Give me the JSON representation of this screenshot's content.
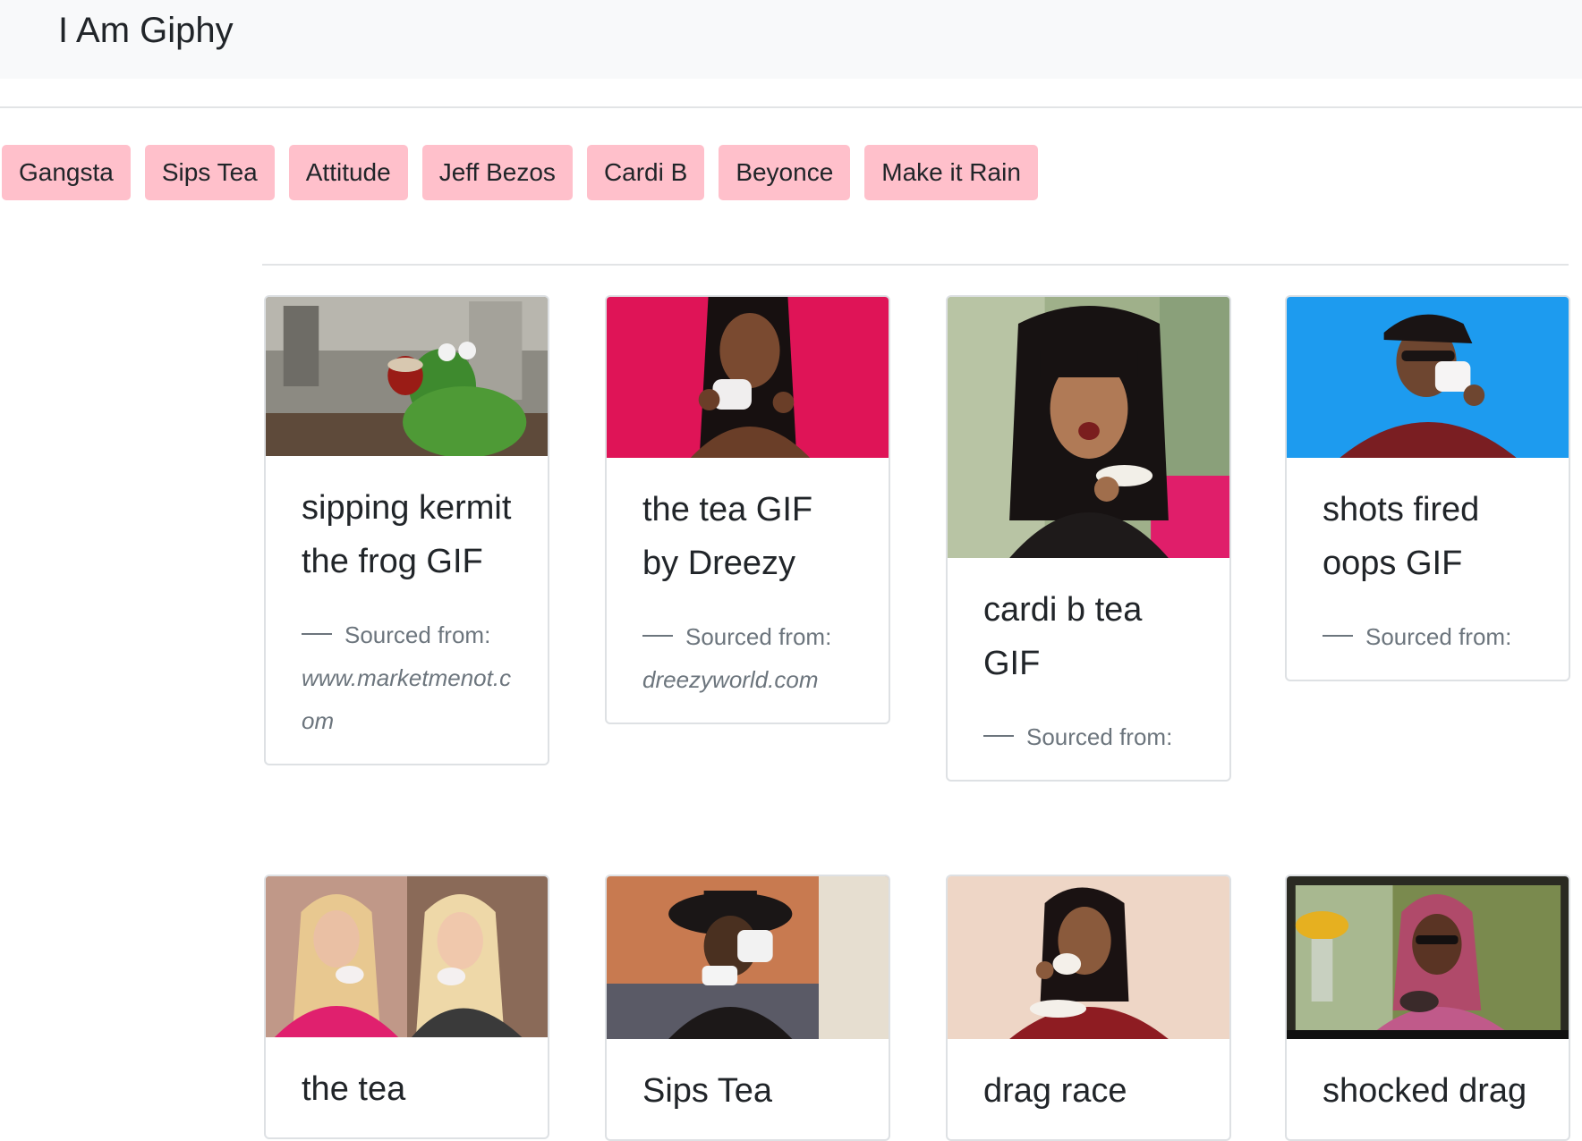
{
  "navbar": {
    "brand": "I Am Giphy"
  },
  "topics": [
    "Gangsta",
    "Sips Tea",
    "Attitude",
    "Jeff Bezos",
    "Cardi B",
    "Beyonce",
    "Make it Rain"
  ],
  "cards": [
    {
      "title": "sipping kermit the frog GIF",
      "source_label": "Sourced from:",
      "source_url": "www.marketmenot.com"
    },
    {
      "title": "the tea GIF by Dreezy",
      "source_label": "Sourced from:",
      "source_url": "dreezyworld.com"
    },
    {
      "title": "cardi b tea GIF",
      "source_label": "Sourced from:",
      "source_url": ""
    },
    {
      "title": "shots fired oops GIF",
      "source_label": "Sourced from:",
      "source_url": ""
    },
    {
      "title": "the tea",
      "source_label": "",
      "source_url": ""
    },
    {
      "title": "Sips Tea",
      "source_label": "",
      "source_url": ""
    },
    {
      "title": "drag race",
      "source_label": "",
      "source_url": ""
    },
    {
      "title": "shocked drag",
      "source_label": "",
      "source_url": ""
    }
  ],
  "colors": {
    "topic_button": "#ffc0cb",
    "navbar_bg": "#f8f9fa",
    "card_border": "#dee1e4",
    "muted_text": "#6c757d"
  }
}
